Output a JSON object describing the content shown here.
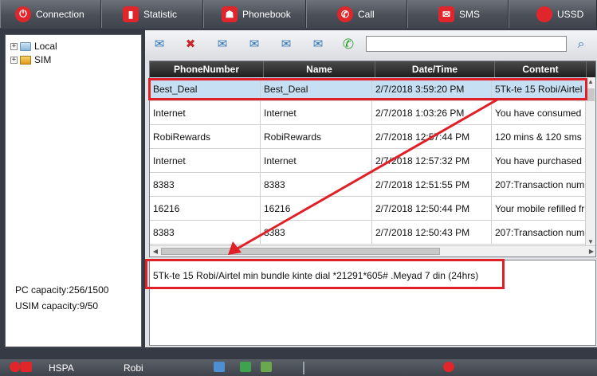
{
  "nav": {
    "tabs": [
      {
        "label": "Connection",
        "icon": "power-icon"
      },
      {
        "label": "Statistic",
        "icon": "bar-chart-icon"
      },
      {
        "label": "Phonebook",
        "icon": "phonebook-icon"
      },
      {
        "label": "Call",
        "icon": "phone-icon"
      },
      {
        "label": "SMS",
        "icon": "envelope-icon"
      },
      {
        "label": "USSD",
        "icon": "ussd-icon"
      }
    ]
  },
  "tree": {
    "items": [
      {
        "label": "Local",
        "expander": "+"
      },
      {
        "label": "SIM",
        "expander": "+"
      }
    ],
    "pc_capacity": "PC capacity:256/1500",
    "usim_capacity": "USIM capacity:9/50"
  },
  "toolbar": {
    "icons": [
      "new-message-icon",
      "delete-message-icon",
      "reply-icon",
      "forward-icon",
      "export-icon",
      "import-icon",
      "call-icon"
    ],
    "search_value": "",
    "search_icon": "search-icon"
  },
  "grid": {
    "columns": [
      "PhoneNumber",
      "Name",
      "Date/Time",
      "Content"
    ],
    "rows": [
      {
        "phone": "Best_Deal",
        "name": "Best_Deal",
        "datetime": "2/7/2018 3:59:20 PM",
        "content": "5Tk-te 15 Robi/Airtel"
      },
      {
        "phone": "Internet",
        "name": "Internet",
        "datetime": "2/7/2018 1:03:26 PM",
        "content": "You have consumed"
      },
      {
        "phone": "RobiRewards",
        "name": "RobiRewards",
        "datetime": "2/7/2018 12:57:44 PM",
        "content": "120 mins & 120 sms"
      },
      {
        "phone": "Internet",
        "name": "Internet",
        "datetime": "2/7/2018 12:57:32 PM",
        "content": "You have purchased"
      },
      {
        "phone": "8383",
        "name": "8383",
        "datetime": "2/7/2018 12:51:55 PM",
        "content": "207:Transaction num"
      },
      {
        "phone": "16216",
        "name": "16216",
        "datetime": "2/7/2018 12:50:44 PM",
        "content": "Your mobile refilled fr"
      },
      {
        "phone": "8383",
        "name": "8383",
        "datetime": "2/7/2018 12:50:43 PM",
        "content": "207:Transaction num"
      }
    ]
  },
  "preview": {
    "text": "5Tk-te 15 Robi/Airtel min bundle kinte dial *21291*605# .Meyad 7 din (24hrs)"
  },
  "status": {
    "network": "HSPA",
    "operator": "Robi"
  },
  "colors": {
    "accent_red": "#e01f26",
    "selection": "#c7dff2"
  }
}
